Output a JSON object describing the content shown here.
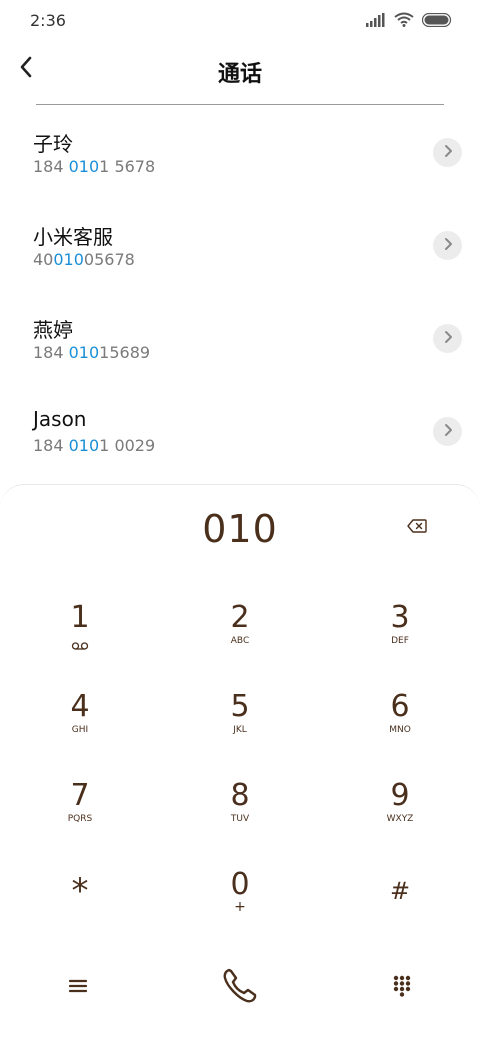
{
  "status_bar": {
    "time": "2:36",
    "icons": [
      "signal-icon",
      "wifi-icon",
      "battery-icon"
    ]
  },
  "header": {
    "title": "通话",
    "back_icon": "chevron-left-icon"
  },
  "contacts": [
    {
      "name": "子玲",
      "number_pre": "184 ",
      "number_hl": "010",
      "number_post": "1 5678"
    },
    {
      "name": "小米客服",
      "number_pre": "40",
      "number_hl": "010",
      "number_post": "05678"
    },
    {
      "name": "燕婷",
      "number_pre": "184 ",
      "number_hl": "010",
      "number_post": "15689"
    },
    {
      "name": "Jason",
      "number_pre": "184 ",
      "number_hl": "010",
      "number_post": "1 0029"
    }
  ],
  "dialpad": {
    "display": "010",
    "keys": [
      {
        "num": "1",
        "letters": ""
      },
      {
        "num": "2",
        "letters": "ABC"
      },
      {
        "num": "3",
        "letters": "DEF"
      },
      {
        "num": "4",
        "letters": "GHI"
      },
      {
        "num": "5",
        "letters": "JKL"
      },
      {
        "num": "6",
        "letters": "MNO"
      },
      {
        "num": "7",
        "letters": "PQRS"
      },
      {
        "num": "8",
        "letters": "TUV"
      },
      {
        "num": "9",
        "letters": "WXYZ"
      },
      {
        "num": "*",
        "letters": ""
      },
      {
        "num": "0",
        "letters": "+"
      },
      {
        "num": "#",
        "letters": ""
      }
    ]
  },
  "colors": {
    "accent_highlight": "#1a8fd7",
    "dial_text": "#4a2f1c",
    "chevron_bg": "#ececec"
  }
}
